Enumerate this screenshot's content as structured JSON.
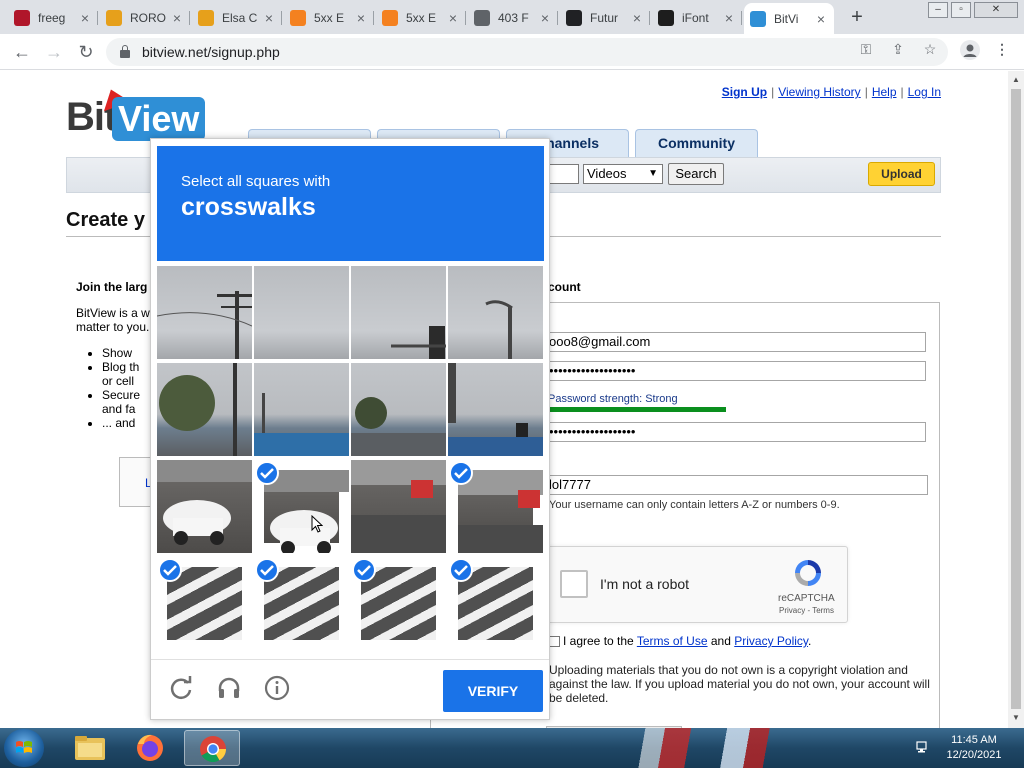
{
  "browser": {
    "tabs": [
      {
        "label": "freeg",
        "favicon": "gamepad-favicon",
        "color": "#b0162a"
      },
      {
        "label": "RORO",
        "favicon": "pinwheel-favicon",
        "color": "#e6a01b"
      },
      {
        "label": "Elsa C",
        "favicon": "pinwheel-favicon",
        "color": "#e6a01b"
      },
      {
        "label": "5xx E",
        "favicon": "cloud-favicon",
        "color": "#f48120"
      },
      {
        "label": "5xx E",
        "favicon": "cloud-favicon",
        "color": "#f48120"
      },
      {
        "label": "403 F",
        "favicon": "globe-favicon",
        "color": "#5f6368"
      },
      {
        "label": "Futur",
        "favicon": "g-favicon",
        "color": "#202124"
      },
      {
        "label": "iFont",
        "favicon": "ifont-favicon",
        "color": "#1d1d1d"
      },
      {
        "label": "BitVi",
        "favicon": "bitview-favicon",
        "color": "#2f8fd6",
        "active": true
      }
    ],
    "tab_close_glyph": "×",
    "new_tab_glyph": "+",
    "address": "bitview.net/signup.php"
  },
  "site": {
    "logo": {
      "part1": "Bit",
      "part2": "View"
    },
    "top_links": {
      "signup": "Sign Up",
      "history": "Viewing History",
      "help": "Help",
      "login": "Log In",
      "separator": "|"
    },
    "nav_tabs": [
      "Channels",
      "Community"
    ],
    "search": {
      "category": "Videos",
      "button": "Search"
    },
    "upload_label": "Upload",
    "page_title": "Create y",
    "join_heading": "Join the larg",
    "intro_lines": [
      "BitView is a w",
      "matter to you."
    ],
    "features": [
      "Show",
      "Blog th",
      "or cell",
      "Secure",
      "and fa",
      "... and"
    ],
    "login_box_label": "L",
    "create_heading": "count",
    "form": {
      "email": "ooo8@gmail.com",
      "password": "•••••••••••••••••••",
      "password_strength": "Password strength: Strong",
      "password_confirm": "•••••••••••••••••••",
      "username": "lol7777",
      "username_hint": "Your username can only contain letters A-Z or numbers 0-9.",
      "agree_prefix": "I agree to the ",
      "terms_link": "Terms of Use",
      "agree_and": " and ",
      "privacy_link": "Privacy Policy",
      "agree_suffix": ".",
      "warning": "Uploading materials that you do not own is a copyright violation and against the law. If you upload material you do not own, your account will be deleted."
    },
    "recaptcha": {
      "label": "I'm not a robot",
      "brand": "reCAPTCHA",
      "legal": "Privacy - Terms"
    }
  },
  "challenge": {
    "instruction": "Select all squares with",
    "target": "crosswalks",
    "tiles_selected": [
      false,
      false,
      false,
      false,
      false,
      false,
      false,
      false,
      false,
      true,
      false,
      true,
      true,
      true,
      true,
      true
    ],
    "verify_label": "VERIFY",
    "footer_icons": [
      "reload-icon",
      "audio-icon",
      "info-icon"
    ]
  },
  "taskbar": {
    "apps": [
      "start-button",
      "file-explorer-icon",
      "firefox-icon",
      "chrome-icon"
    ],
    "time": "11:45 AM",
    "date": "12/20/2021"
  }
}
